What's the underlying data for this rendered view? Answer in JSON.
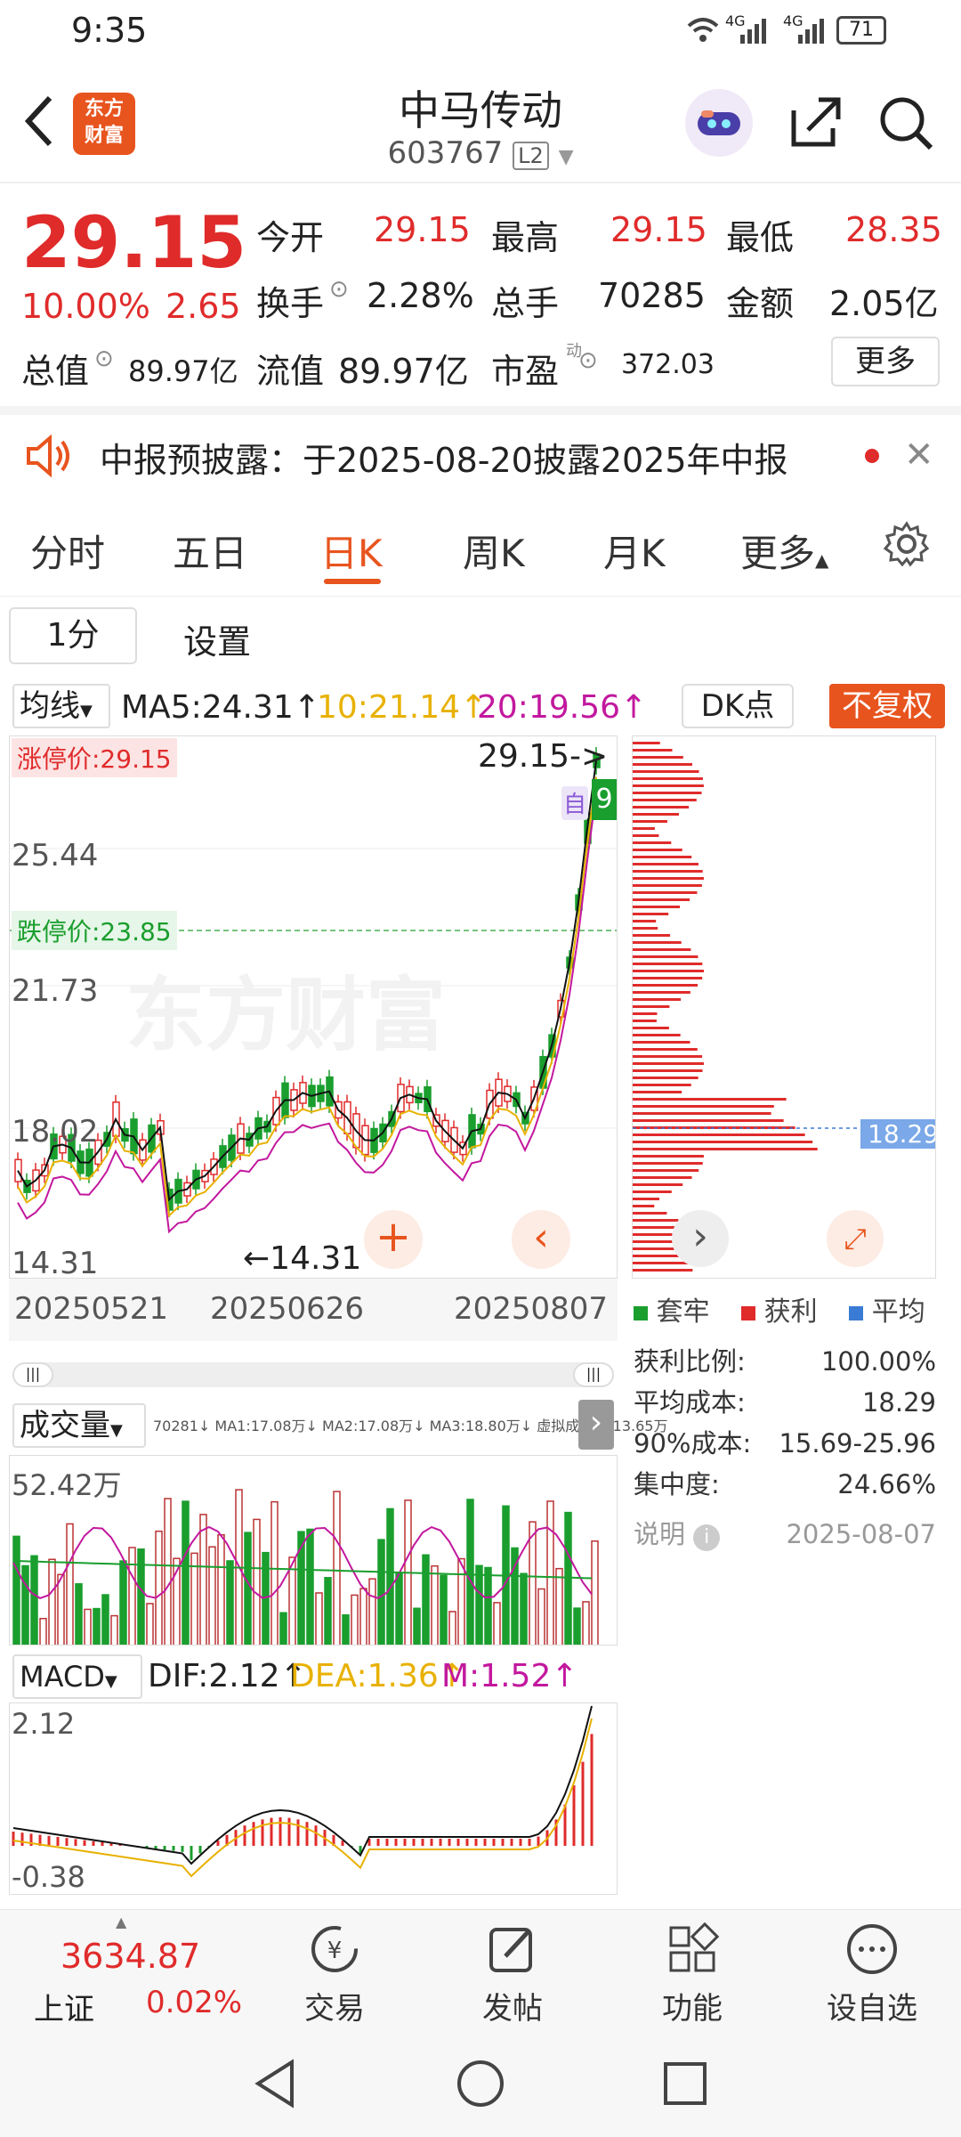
{
  "status": {
    "time": "9:35",
    "battery": "71",
    "net1": "4G",
    "net2": "4G"
  },
  "header": {
    "logo_line1": "东方",
    "logo_line2": "财富",
    "name": "中马传动",
    "code": "603767",
    "level": "L2"
  },
  "quote": {
    "price": "29.15",
    "change_pct": "10.00%",
    "change": "2.65",
    "open_label": "今开",
    "open": "29.15",
    "high_label": "最高",
    "high": "29.15",
    "low_label": "最低",
    "low": "28.35",
    "turnover_label": "换手",
    "turnover": "2.28%",
    "volume_label": "总手",
    "volume": "70285",
    "amount_label": "金额",
    "amount": "2.05亿",
    "mktcap_label": "总值",
    "mktcap": "89.97亿",
    "float_label": "流值",
    "float": "89.97亿",
    "pe_label": "市盈",
    "pe_sup": "动",
    "pe": "372.03",
    "more": "更多"
  },
  "notice": {
    "text": "中报预披露：于2025-08-20披露2025年中报"
  },
  "tabs": [
    "分时",
    "五日",
    "日K",
    "周K",
    "月K",
    "更多"
  ],
  "active_tab": 2,
  "subtabs": {
    "period": "1分",
    "settings": "设置"
  },
  "ma": {
    "selector": "均线",
    "ma5": "MA5:24.31↑",
    "ma10": "10:21.14↑",
    "ma20": "20:19.56↑",
    "dk": "DK点",
    "fq": "不复权"
  },
  "kchart": {
    "limit_up": "涨停价:29.15",
    "limit_down": "跌停价:23.85",
    "last_tag": "29.15->",
    "y_labels": [
      "25.44",
      "21.73",
      "18.02",
      "14.31"
    ],
    "low_mark": "←14.31",
    "dates": [
      "20250521",
      "20250626",
      "20250807"
    ],
    "watermark": "东方财富",
    "badge_zi": "自",
    "badge_9": "9"
  },
  "chips": {
    "avg_tag": "18.29",
    "legend": [
      "套牢",
      "获利",
      "平均"
    ],
    "rows": [
      {
        "label": "获利比例:",
        "value": "100.00%"
      },
      {
        "label": "平均成本:",
        "value": "18.29"
      },
      {
        "label": "90%成本:",
        "value": "15.69-25.96"
      },
      {
        "label": "集中度:",
        "value": "24.66%"
      }
    ],
    "note_label": "说明",
    "date": "2025-08-07"
  },
  "volume": {
    "selector": "成交量",
    "line": "70281↓ MA1:17.08万↓ MA2:17.08万↓ MA3:18.80万↓ 虚拟成交量:13.65万",
    "max_label": "52.42万"
  },
  "macd": {
    "selector": "MACD",
    "dif": "DIF:2.12↑",
    "dea": "DEA:1.36↑",
    "m": "M:1.52↑",
    "top": "2.12",
    "bottom": "-0.38"
  },
  "bottom": {
    "index_value": "3634.87",
    "index_name": "上证",
    "index_pct": "0.02%",
    "nav": [
      "交易",
      "发帖",
      "功能",
      "设自选"
    ]
  },
  "colors": {
    "up": "#e02b2b",
    "down": "#1a9e2e",
    "accent": "#e8541e",
    "blue": "#3a7bd5"
  }
}
